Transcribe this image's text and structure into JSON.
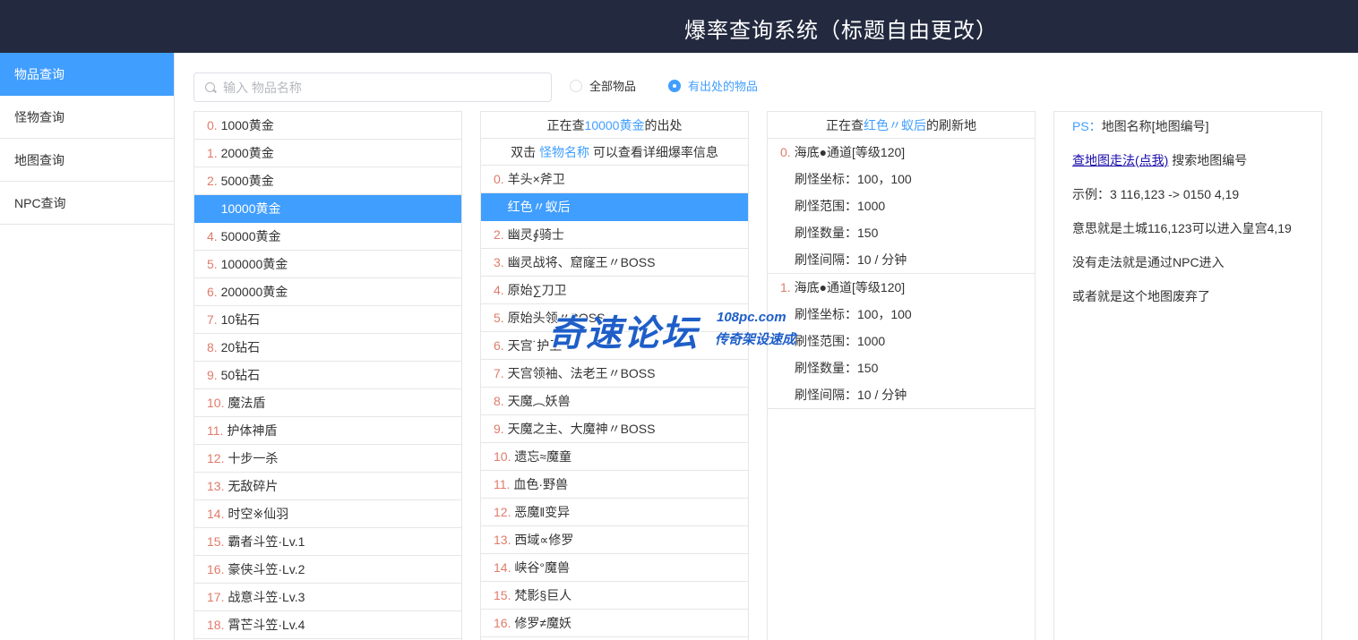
{
  "header": {
    "title": "爆率查询系统（标题自由更改）"
  },
  "sidebar": {
    "items": [
      {
        "label": "物品查询",
        "active": true
      },
      {
        "label": "怪物查询",
        "active": false
      },
      {
        "label": "地图查询",
        "active": false
      },
      {
        "label": "NPC查询",
        "active": false
      }
    ]
  },
  "search": {
    "placeholder": "输入 物品名称",
    "value": ""
  },
  "filters": {
    "all_label": "全部物品",
    "has_source_label": "有出处的物品",
    "selected": "has_source"
  },
  "items": [
    {
      "idx": "0.",
      "name": "1000黄金"
    },
    {
      "idx": "1.",
      "name": "2000黄金"
    },
    {
      "idx": "2.",
      "name": "5000黄金"
    },
    {
      "idx": "3.",
      "name": "10000黄金"
    },
    {
      "idx": "4.",
      "name": "50000黄金"
    },
    {
      "idx": "5.",
      "name": "100000黄金"
    },
    {
      "idx": "6.",
      "name": "200000黄金"
    },
    {
      "idx": "7.",
      "name": "10钻石"
    },
    {
      "idx": "8.",
      "name": "20钻石"
    },
    {
      "idx": "9.",
      "name": "50钻石"
    },
    {
      "idx": "10.",
      "name": "魔法盾"
    },
    {
      "idx": "11.",
      "name": "护体神盾"
    },
    {
      "idx": "12.",
      "name": "十步一杀"
    },
    {
      "idx": "13.",
      "name": "无敌碎片"
    },
    {
      "idx": "14.",
      "name": "时空※仙羽"
    },
    {
      "idx": "15.",
      "name": "霸者斗笠·Lv.1"
    },
    {
      "idx": "16.",
      "name": "豪侠斗笠·Lv.2"
    },
    {
      "idx": "17.",
      "name": "战意斗笠·Lv.3"
    },
    {
      "idx": "18.",
      "name": "霄芒斗笠·Lv.4"
    }
  ],
  "selected_item_index": 3,
  "sources": {
    "header_prefix": "正在查",
    "header_item": "10000黄金",
    "header_suffix": "的出处",
    "hint_prefix": "双击",
    "hint_link": "怪物名称",
    "hint_suffix": "可以查看详细爆率信息",
    "monsters": [
      {
        "idx": "0.",
        "name": "羊头×斧卫"
      },
      {
        "idx": "1.",
        "name": "红色〃蚁后"
      },
      {
        "idx": "2.",
        "name": "幽灵∮骑士"
      },
      {
        "idx": "3.",
        "name": "幽灵战将、窟窿王〃BOSS"
      },
      {
        "idx": "4.",
        "name": "原始∑刀卫"
      },
      {
        "idx": "5.",
        "name": "原始头领〃BOSS"
      },
      {
        "idx": "6.",
        "name": "天宫˙护卫"
      },
      {
        "idx": "7.",
        "name": "天宫领袖、法老王〃BOSS"
      },
      {
        "idx": "8.",
        "name": "天魔︵妖兽"
      },
      {
        "idx": "9.",
        "name": "天魔之主、大魔神〃BOSS"
      },
      {
        "idx": "10.",
        "name": "遗忘≈魔童"
      },
      {
        "idx": "11.",
        "name": "血色·野兽"
      },
      {
        "idx": "12.",
        "name": "恶魔‖变异"
      },
      {
        "idx": "13.",
        "name": "西域∝修罗"
      },
      {
        "idx": "14.",
        "name": "峡谷°魔兽"
      },
      {
        "idx": "15.",
        "name": "梵影§巨人"
      },
      {
        "idx": "16.",
        "name": "修罗≠魔妖"
      }
    ],
    "selected_monster_index": 1
  },
  "spawns": {
    "header_prefix": "正在查",
    "header_monster": "红色〃蚁后",
    "header_suffix": "的刷新地",
    "list": [
      {
        "idx": "0.",
        "map": "海底●通道[等级120]",
        "coord": "刷怪坐标：100，100",
        "range": "刷怪范围：1000",
        "count": "刷怪数量：150",
        "interval": "刷怪间隔：10 / 分钟"
      },
      {
        "idx": "1.",
        "map": "海底●通道[等级120]",
        "coord": "刷怪坐标：100，100",
        "range": "刷怪范围：1000",
        "count": "刷怪数量：150",
        "interval": "刷怪间隔：10 / 分钟"
      }
    ]
  },
  "notes": {
    "ps_label": "PS：",
    "ps_text": "地图名称[地图编号]",
    "walk_link": "查地图走法(点我)",
    "walk_suffix": " 搜索地图编号",
    "example": "示例：3 116,123 -> 0150 4,19",
    "meaning": "意思就是土城116,123可以进入皇宫4,19",
    "no_walk": "没有走法就是通过NPC进入",
    "abandoned": "或者就是这个地图废弃了"
  },
  "watermark": {
    "brand": "奇速论坛",
    "site": "108pc.com",
    "slogan": "传奇架设速成"
  },
  "colors": {
    "header_bg": "#232a3f",
    "accent": "#409eff",
    "index_red": "#e07b6a",
    "watermark_blue": "#1e5ec8"
  }
}
